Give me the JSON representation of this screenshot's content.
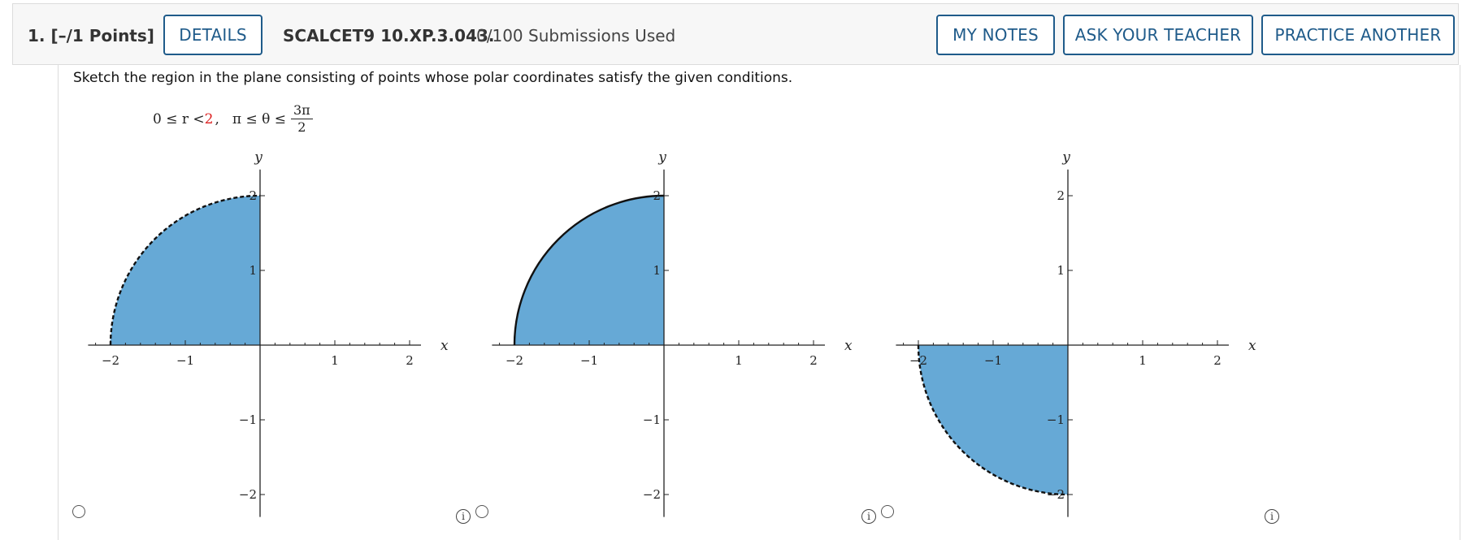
{
  "header": {
    "question_number": "1.",
    "points": "[–/1 Points]",
    "details_label": "DETAILS",
    "problem_code": "SCALCET9 10.XP.3.043.",
    "submissions": "0/100 Submissions Used",
    "my_notes_label": "MY NOTES",
    "ask_teacher_label": "ASK YOUR TEACHER",
    "practice_another_label": "PRACTICE ANOTHER"
  },
  "question": {
    "prompt": "Sketch the region in the plane consisting of points whose polar coordinates satisfy the given conditions.",
    "condition_left": "0 ≤ r < ",
    "condition_red": "2",
    "condition_comma": ",",
    "condition_theta": "π ≤ θ ≤",
    "fraction_num": "3π",
    "fraction_den": "2"
  },
  "colors": {
    "fill": "#66a9d6",
    "button_accent": "#1f5b8a",
    "highlight_red": "#d22222"
  },
  "graph_labels": {
    "x_axis": "x",
    "y_axis": "y",
    "ticks_x": [
      "−2",
      "−1",
      "1",
      "2"
    ],
    "ticks_y": [
      "2",
      "1",
      "−1",
      "−2"
    ]
  },
  "info_symbol": "i",
  "options": [
    {
      "id": "a",
      "quadrant": "second",
      "boundary": "dashed"
    },
    {
      "id": "b",
      "quadrant": "second",
      "boundary": "solid"
    },
    {
      "id": "c",
      "quadrant": "third",
      "boundary": "dashed"
    }
  ]
}
